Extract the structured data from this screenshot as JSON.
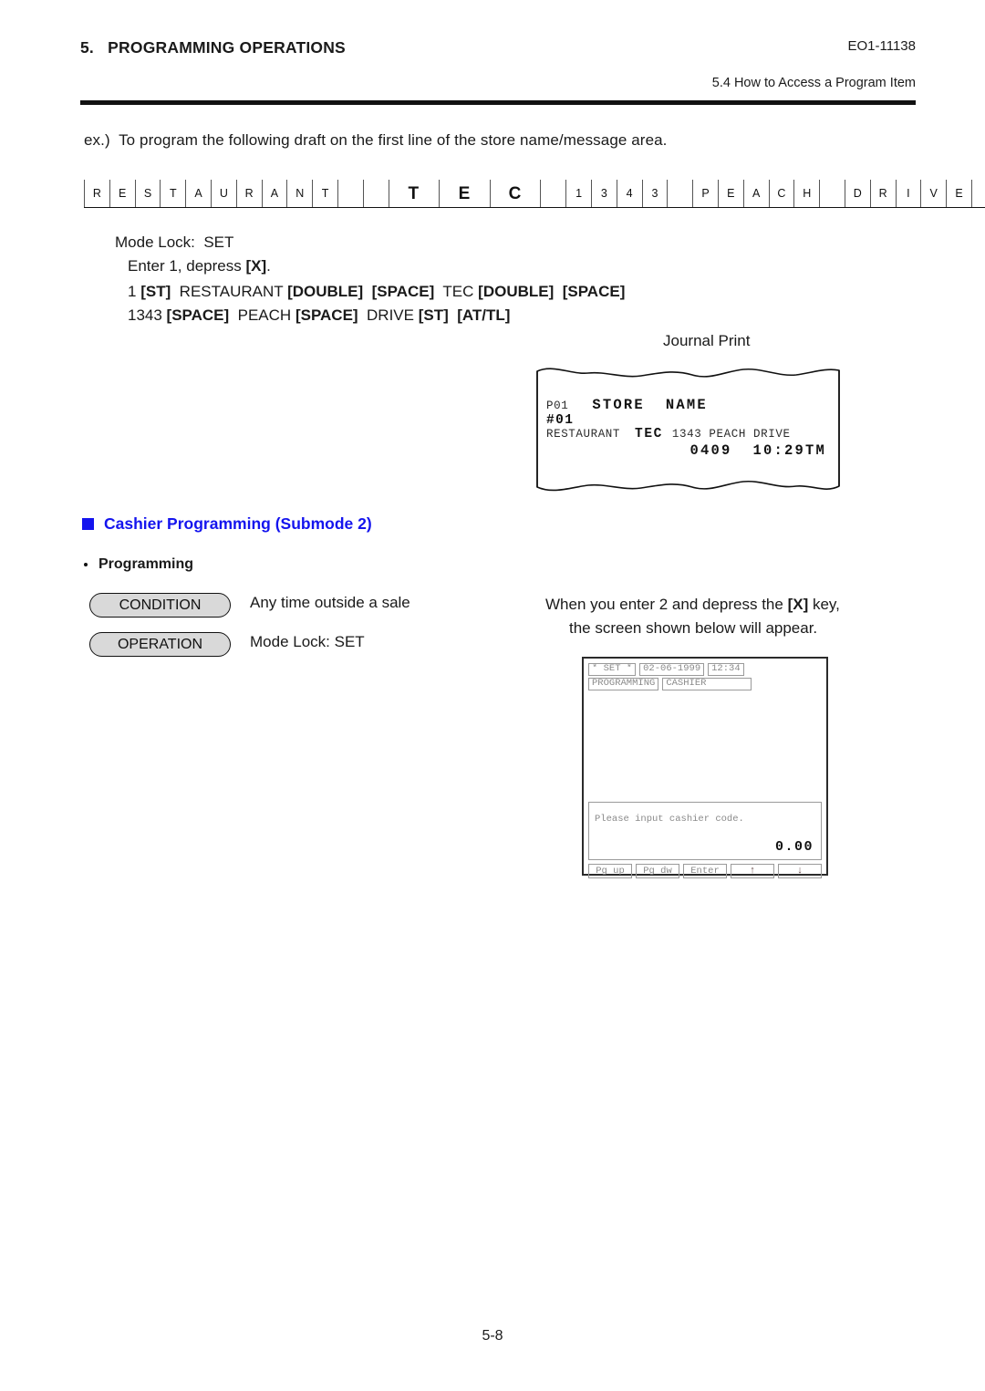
{
  "header": {
    "chapter": "5.   PROGRAMMING OPERATIONS",
    "doc_code": "EO1-11138",
    "section": "5.4  How to Access a Program Item"
  },
  "intro": "ex.)  To program the following draft on the first line of the store name/message area.",
  "char_grid": {
    "cells": [
      {
        "ch": "R",
        "wide": false
      },
      {
        "ch": "E",
        "wide": false
      },
      {
        "ch": "S",
        "wide": false
      },
      {
        "ch": "T",
        "wide": false
      },
      {
        "ch": "A",
        "wide": false
      },
      {
        "ch": "U",
        "wide": false
      },
      {
        "ch": "R",
        "wide": false
      },
      {
        "ch": "A",
        "wide": false
      },
      {
        "ch": "N",
        "wide": false
      },
      {
        "ch": "T",
        "wide": false
      },
      {
        "ch": " ",
        "wide": false
      },
      {
        "ch": " ",
        "wide": false
      },
      {
        "ch": "T",
        "wide": true
      },
      {
        "ch": "E",
        "wide": true
      },
      {
        "ch": "C",
        "wide": true
      },
      {
        "ch": " ",
        "wide": false
      },
      {
        "ch": "1",
        "wide": false
      },
      {
        "ch": "3",
        "wide": false
      },
      {
        "ch": "4",
        "wide": false
      },
      {
        "ch": "3",
        "wide": false
      },
      {
        "ch": " ",
        "wide": false
      },
      {
        "ch": "P",
        "wide": false
      },
      {
        "ch": "E",
        "wide": false
      },
      {
        "ch": "A",
        "wide": false
      },
      {
        "ch": "C",
        "wide": false
      },
      {
        "ch": "H",
        "wide": false
      },
      {
        "ch": " ",
        "wide": false
      },
      {
        "ch": "D",
        "wide": false
      },
      {
        "ch": "R",
        "wide": false
      },
      {
        "ch": "I",
        "wide": false
      },
      {
        "ch": "V",
        "wide": false
      },
      {
        "ch": "E",
        "wide": false
      },
      {
        "ch": " ",
        "wide": false
      },
      {
        "ch": " ",
        "wide": false
      },
      {
        "ch": " ",
        "wide": false
      },
      {
        "ch": " ",
        "wide": false
      },
      {
        "ch": " ",
        "wide": false
      }
    ]
  },
  "procedure": {
    "mode_lock": "Mode Lock:  SET",
    "enter_line_a": "Enter 1, depress ",
    "enter_key": "[X]",
    "enter_line_b": ".",
    "seq_line1_parts": [
      {
        "t": "1 ",
        "b": false
      },
      {
        "t": "[ST]",
        "b": true
      },
      {
        "t": "  RESTAURANT ",
        "b": false
      },
      {
        "t": "[DOUBLE]",
        "b": true
      },
      {
        "t": "  ",
        "b": false
      },
      {
        "t": "[SPACE]",
        "b": true
      },
      {
        "t": "  TEC ",
        "b": false
      },
      {
        "t": "[DOUBLE]",
        "b": true
      },
      {
        "t": "  ",
        "b": false
      },
      {
        "t": "[SPACE]",
        "b": true
      }
    ],
    "seq_line2_parts": [
      {
        "t": "1343 ",
        "b": false
      },
      {
        "t": "[SPACE]",
        "b": true
      },
      {
        "t": "  PEACH ",
        "b": false
      },
      {
        "t": "[SPACE]",
        "b": true
      },
      {
        "t": "  DRIVE ",
        "b": false
      },
      {
        "t": "[ST]",
        "b": true
      },
      {
        "t": "  ",
        "b": false
      },
      {
        "t": "[AT/TL]",
        "b": true
      }
    ]
  },
  "journal": {
    "label": "Journal Print",
    "line1_left": "P01",
    "line1_big": "STORE  NAME",
    "line2": "#01",
    "line3_left": "RESTAURANT",
    "line3_mid": "TEC",
    "line3_right": "1343 PEACH DRIVE",
    "line4": "0409  10:29TM"
  },
  "section": {
    "heading": "Cashier Programming (Submode 2)",
    "heading_color": "#1414ee",
    "subheading": "Programming"
  },
  "blocks": {
    "condition_label": "CONDITION",
    "condition_text": "Any time outside a sale",
    "operation_label": "OPERATION",
    "operation_text": "Mode Lock:  SET"
  },
  "note": {
    "line1_a": "When you enter 2 and depress the ",
    "line1_key": "[X]",
    "line1_b": " key,",
    "line2": "the screen shown below will appear."
  },
  "lcd": {
    "mode": "* SET *",
    "date": "02-06-1999",
    "time": "12:34",
    "menu": "PROGRAMMING",
    "submenu": "CASHIER",
    "message": "Please input cashier code.",
    "amount": "0.00",
    "keys": [
      "Pg up",
      "Pg dw",
      "Enter",
      "↑",
      "↓"
    ]
  },
  "footer": {
    "page": "5-8"
  }
}
